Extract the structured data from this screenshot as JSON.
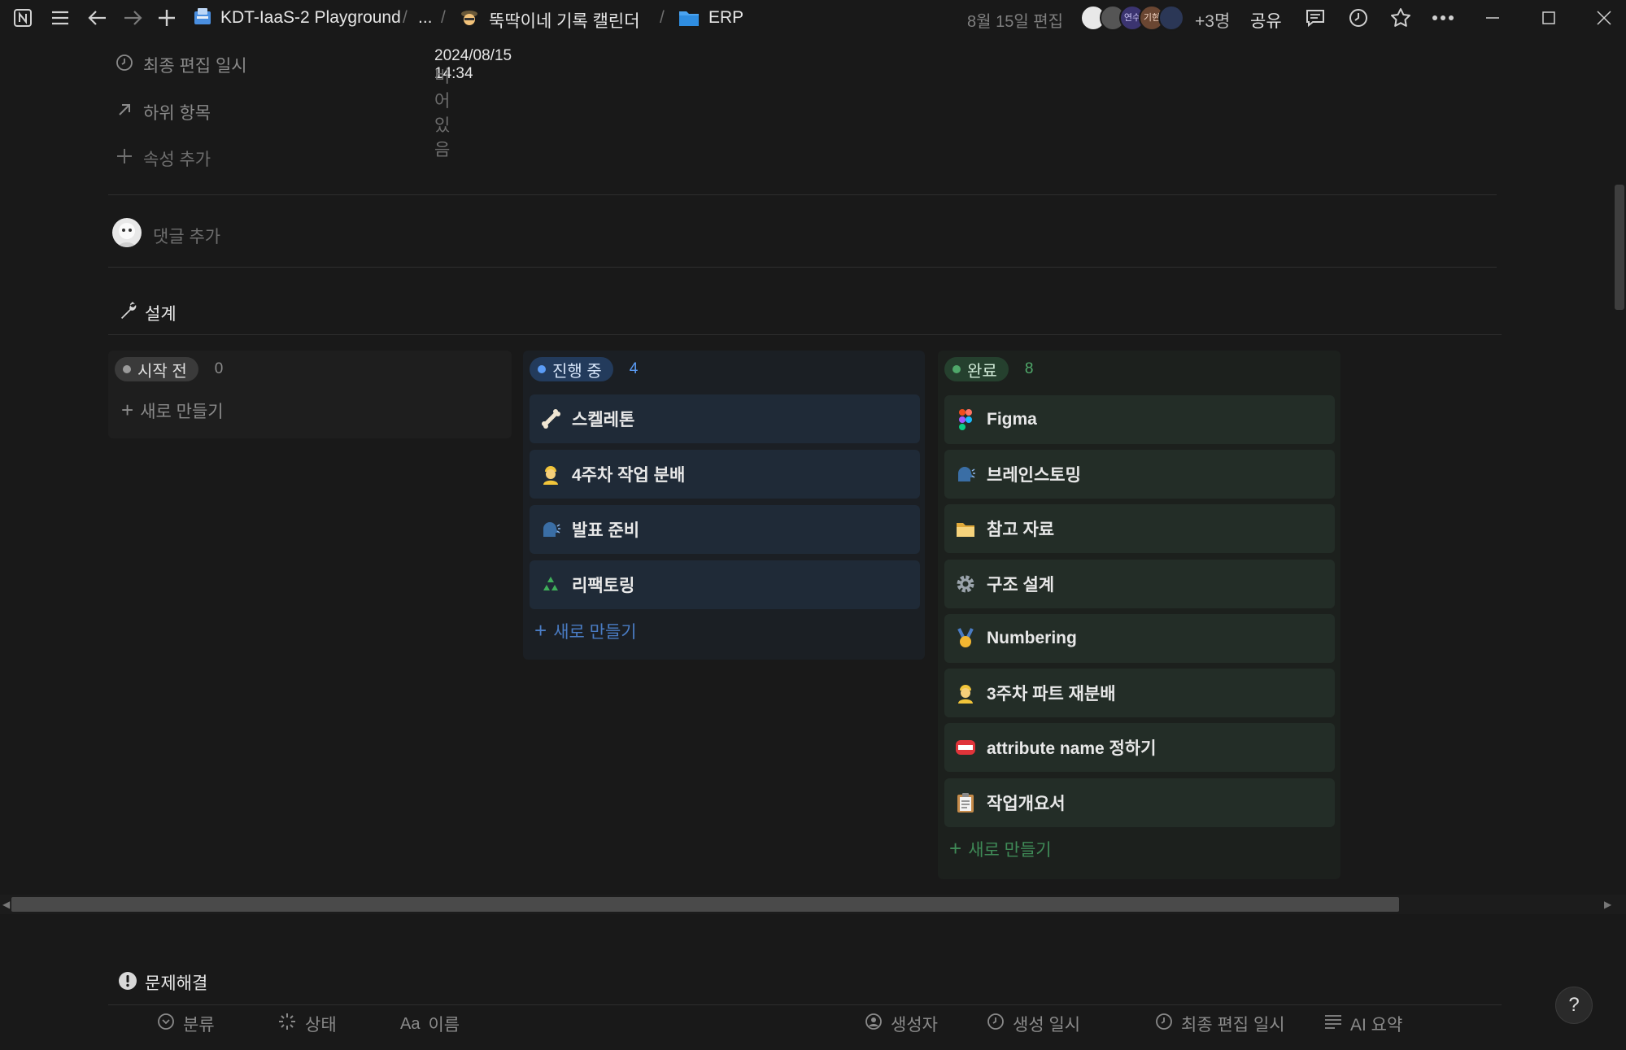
{
  "topbar": {
    "workspace": "KDT-IaaS-2 Playground",
    "ellipsis": "...",
    "calendar": "뚝딱이네 기록 캘린더",
    "folder": "ERP",
    "edited": "8월 15일 편집",
    "more_people": "+3명",
    "share": "공유",
    "avatar_text_1": "연수",
    "avatar_text_2": "기현"
  },
  "properties": {
    "last_edited_label": "최종 편집 일시",
    "last_edited_value": "2024/08/15 14:34",
    "sub_items_label": "하위 항목",
    "sub_items_value": "비어 있음",
    "add_property": "속성 추가"
  },
  "comment": {
    "placeholder": "댓글 추가"
  },
  "section_design": {
    "title": "설계"
  },
  "board": {
    "columns": [
      {
        "label": "시작 전",
        "count": "0",
        "new": "새로 만들기",
        "cards": []
      },
      {
        "label": "진행 중",
        "count": "4",
        "new": "새로 만들기",
        "cards": [
          {
            "title": "스켈레톤",
            "icon": "bone-icon"
          },
          {
            "title": "4주차 작업 분배",
            "icon": "worker-icon"
          },
          {
            "title": "발표 준비",
            "icon": "speaking-head-icon"
          },
          {
            "title": "리팩토링",
            "icon": "recycle-icon"
          }
        ]
      },
      {
        "label": "완료",
        "count": "8",
        "new": "새로 만들기",
        "cards": [
          {
            "title": "Figma",
            "icon": "figma-icon"
          },
          {
            "title": "브레인스토밍",
            "icon": "speaking-head-icon"
          },
          {
            "title": "참고 자료",
            "icon": "folder-icon"
          },
          {
            "title": "구조 설계",
            "icon": "gear-icon"
          },
          {
            "title": "Numbering",
            "icon": "medal-icon"
          },
          {
            "title": "3주차 파트 재분배",
            "icon": "worker-icon"
          },
          {
            "title": "attribute name 정하기",
            "icon": "name-badge-icon"
          },
          {
            "title": "작업개요서",
            "icon": "clipboard-icon"
          }
        ]
      }
    ]
  },
  "section_problem": {
    "title": "문제해결"
  },
  "table_headers": {
    "category": "분류",
    "status": "상태",
    "name": "이름",
    "name_prefix": "Aa",
    "creator": "생성자",
    "created": "생성 일시",
    "last_edited": "최종 편집 일시",
    "ai_summary": "AI 요약"
  },
  "help": "?",
  "colors": {
    "bg": "#191919",
    "blue": "#5b9cf6",
    "green": "#4fa86a",
    "card_blue": "#1f2a37",
    "card_green": "#232d27"
  }
}
